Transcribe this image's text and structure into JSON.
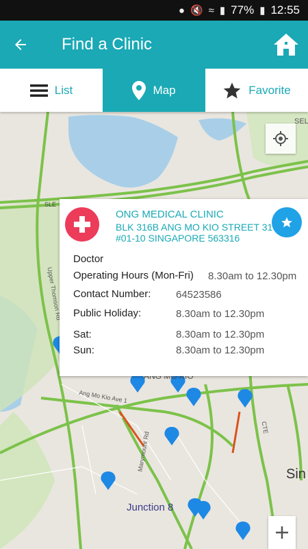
{
  "statusbar": {
    "battery": "77%",
    "time": "12:55"
  },
  "appbar": {
    "title": "Find a Clinic"
  },
  "tabs": [
    {
      "label": "List",
      "icon": "menu-icon"
    },
    {
      "label": "Map",
      "icon": "map-pin-icon"
    },
    {
      "label": "Favorite",
      "icon": "star-icon"
    }
  ],
  "map": {
    "labels": {
      "junction": "Junction 8",
      "sin": "Sin",
      "sle": "SLE",
      "sel": "SEL",
      "upper_thomson": "Upper Thomson Rd",
      "amk_ave": "Ang Mo Kio Ave 1",
      "marymount": "Marymount Rd",
      "cte": "CTE",
      "amk": "ANG MO KIO"
    }
  },
  "popup": {
    "name": "ONG MEDICAL CLINIC",
    "address": "BLK 316B ANG MO KIO STREET 31 #01-10  SINGAPORE 563316",
    "type": "Doctor",
    "operating_hours_label": "Operating Hours (Mon-Fri)",
    "operating_hours_value": "8.30am to 12.30pm",
    "contact_label": "Contact Number:",
    "contact_value": "64523586",
    "public_holiday_label": "Public Holiday:",
    "public_holiday_value": "8.30am to 12.30pm",
    "sat_label": "Sat:",
    "sat_value": "8.30am to 12.30pm",
    "sun_label": "Sun:",
    "sun_value": "8.30am to 12.30pm"
  },
  "colors": {
    "accent": "#1aa9b5",
    "logo": "#ec3c5a",
    "marker": "#1e88e5",
    "road": "#7cc24a"
  }
}
